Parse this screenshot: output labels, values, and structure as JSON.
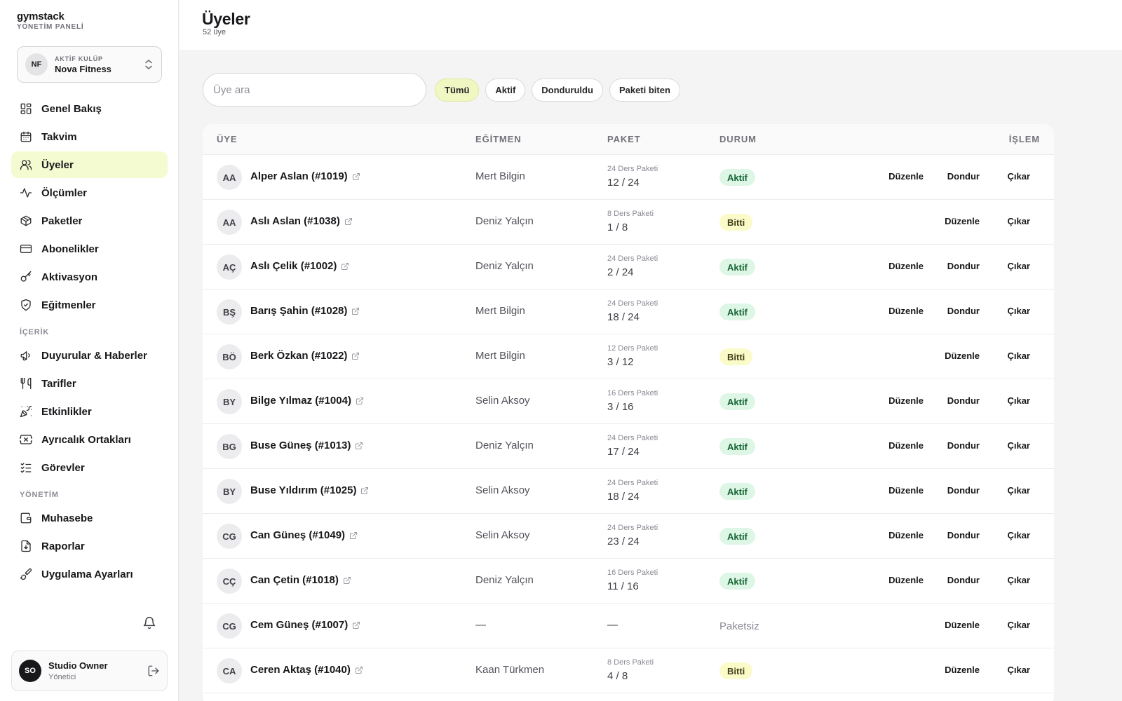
{
  "brand": {
    "name": "gymstack",
    "subtitle": "YÖNETİM PANELİ"
  },
  "club_switcher": {
    "initials": "NF",
    "label": "AKTİF KULÜP",
    "name": "Nova Fitness",
    "icon": "chevron-up-down-icon"
  },
  "nav": {
    "main": [
      {
        "label": "Genel Bakış",
        "icon": "dashboard-grid-icon",
        "active": false
      },
      {
        "label": "Takvim",
        "icon": "calendar-icon",
        "active": false
      },
      {
        "label": "Üyeler",
        "icon": "users-icon",
        "active": true
      },
      {
        "label": "Ölçümler",
        "icon": "activity-icon",
        "active": false
      },
      {
        "label": "Paketler",
        "icon": "package-icon",
        "active": false
      },
      {
        "label": "Abonelikler",
        "icon": "credit-card-icon",
        "active": false
      },
      {
        "label": "Aktivasyon",
        "icon": "key-icon",
        "active": false
      },
      {
        "label": "Eğitmenler",
        "icon": "shield-check-icon",
        "active": false
      }
    ],
    "content_title": "İÇERİK",
    "content": [
      {
        "label": "Duyurular & Haberler",
        "icon": "megaphone-icon"
      },
      {
        "label": "Tarifler",
        "icon": "utensils-icon"
      },
      {
        "label": "Etkinlikler",
        "icon": "party-popper-icon"
      },
      {
        "label": "Ayrıcalık Ortakları",
        "icon": "ticket-icon"
      },
      {
        "label": "Görevler",
        "icon": "list-checks-icon"
      }
    ],
    "management_title": "YÖNETİM",
    "management": [
      {
        "label": "Muhasebe",
        "icon": "wallet-icon"
      },
      {
        "label": "Raporlar",
        "icon": "file-report-icon"
      },
      {
        "label": "Uygulama Ayarları",
        "icon": "paintbrush-icon"
      }
    ]
  },
  "user": {
    "initials": "SO",
    "name": "Studio Owner",
    "role": "Yönetici",
    "logout_icon": "logout-icon"
  },
  "header": {
    "title": "Üyeler",
    "subtitle": "52 üye"
  },
  "search": {
    "placeholder": "Üye ara",
    "value": ""
  },
  "filters": [
    {
      "label": "Tümü",
      "active": true
    },
    {
      "label": "Aktif",
      "active": false
    },
    {
      "label": "Donduruldu",
      "active": false
    },
    {
      "label": "Paketi biten",
      "active": false
    }
  ],
  "table": {
    "columns": {
      "member": "ÜYE",
      "trainer": "EĞİTMEN",
      "package": "PAKET",
      "status": "DURUM",
      "action": "İŞLEM"
    },
    "action_labels": {
      "edit": "Düzenle",
      "freeze": "Dondur",
      "remove": "Çıkar"
    },
    "rows": [
      {
        "initials": "AA",
        "name": "Alper Aslan (#1019)",
        "trainer": "Mert Bilgin",
        "package": "24 Ders Paketi",
        "progress": "12 / 24",
        "status": "Aktif",
        "status_type": "aktif"
      },
      {
        "initials": "AA",
        "name": "Aslı Aslan (#1038)",
        "trainer": "Deniz Yalçın",
        "package": "8 Ders Paketi",
        "progress": "1 / 8",
        "status": "Bitti",
        "status_type": "bitti"
      },
      {
        "initials": "AÇ",
        "name": "Aslı Çelik (#1002)",
        "trainer": "Deniz Yalçın",
        "package": "24 Ders Paketi",
        "progress": "2 / 24",
        "status": "Aktif",
        "status_type": "aktif"
      },
      {
        "initials": "BŞ",
        "name": "Barış Şahin (#1028)",
        "trainer": "Mert Bilgin",
        "package": "24 Ders Paketi",
        "progress": "18 / 24",
        "status": "Aktif",
        "status_type": "aktif"
      },
      {
        "initials": "BÖ",
        "name": "Berk Özkan (#1022)",
        "trainer": "Mert Bilgin",
        "package": "12 Ders Paketi",
        "progress": "3 / 12",
        "status": "Bitti",
        "status_type": "bitti"
      },
      {
        "initials": "BY",
        "name": "Bilge Yılmaz (#1004)",
        "trainer": "Selin Aksoy",
        "package": "16 Ders Paketi",
        "progress": "3 / 16",
        "status": "Aktif",
        "status_type": "aktif"
      },
      {
        "initials": "BG",
        "name": "Buse Güneş (#1013)",
        "trainer": "Deniz Yalçın",
        "package": "24 Ders Paketi",
        "progress": "17 / 24",
        "status": "Aktif",
        "status_type": "aktif"
      },
      {
        "initials": "BY",
        "name": "Buse Yıldırım (#1025)",
        "trainer": "Selin Aksoy",
        "package": "24 Ders Paketi",
        "progress": "18 / 24",
        "status": "Aktif",
        "status_type": "aktif"
      },
      {
        "initials": "CG",
        "name": "Can Güneş (#1049)",
        "trainer": "Selin Aksoy",
        "package": "24 Ders Paketi",
        "progress": "23 / 24",
        "status": "Aktif",
        "status_type": "aktif"
      },
      {
        "initials": "CÇ",
        "name": "Can Çetin (#1018)",
        "trainer": "Deniz Yalçın",
        "package": "16 Ders Paketi",
        "progress": "11 / 16",
        "status": "Aktif",
        "status_type": "aktif"
      },
      {
        "initials": "CG",
        "name": "Cem Güneş (#1007)",
        "trainer": "—",
        "package": "",
        "progress": "—",
        "status": "Paketsiz",
        "status_type": "paketsiz"
      },
      {
        "initials": "CA",
        "name": "Ceren Aktaş (#1040)",
        "trainer": "Kaan Türkmen",
        "package": "8 Ders Paketi",
        "progress": "4 / 8",
        "status": "Bitti",
        "status_type": "bitti"
      }
    ]
  }
}
